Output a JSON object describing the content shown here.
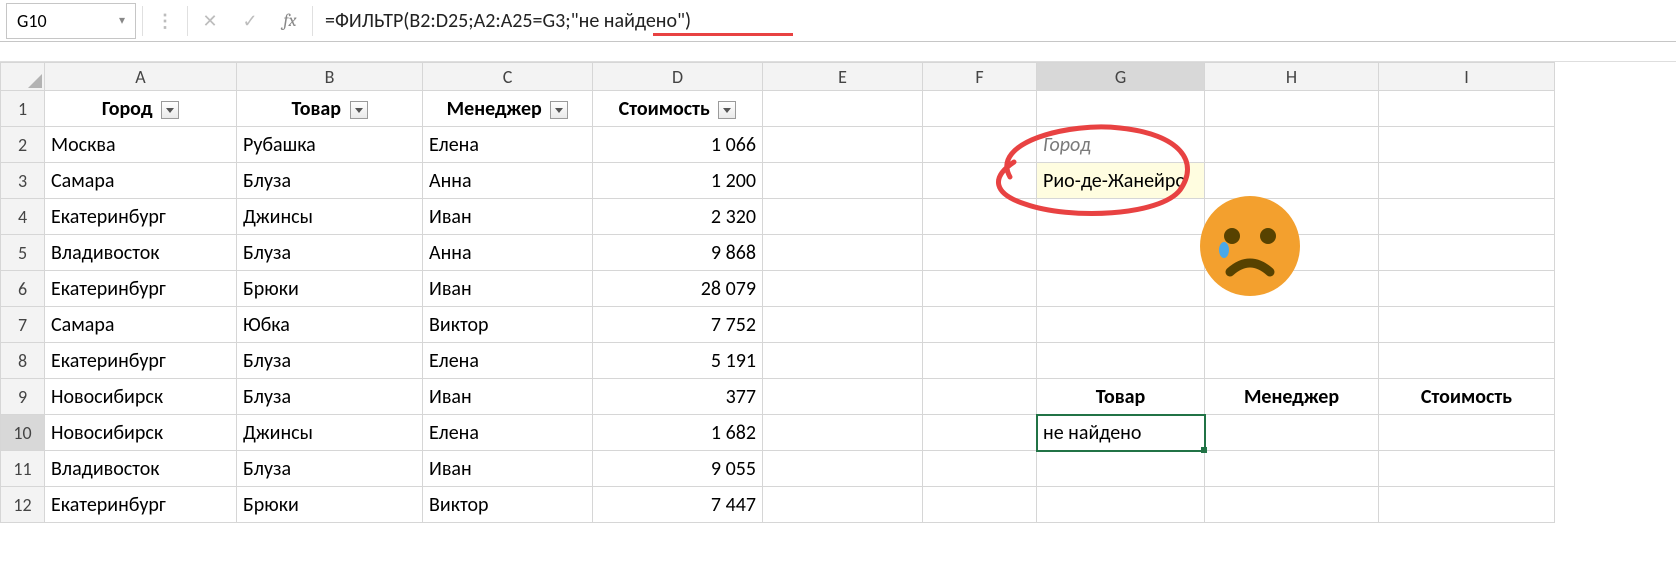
{
  "app": {
    "name_box": "G10",
    "formula": "=ФИЛЬТР(B2:D25;A2:A25=G3;\"не найдено\")"
  },
  "columns": [
    "A",
    "B",
    "C",
    "D",
    "E",
    "F",
    "G",
    "H",
    "I"
  ],
  "row_numbers": [
    1,
    2,
    3,
    4,
    5,
    6,
    7,
    8,
    9,
    10,
    11,
    12
  ],
  "table_headers": {
    "A": "Город",
    "B": "Товар",
    "C": "Менеджер",
    "D": "Стоимость"
  },
  "rows": [
    {
      "A": "Москва",
      "B": "Рубашка",
      "C": "Елена",
      "D": "1 066"
    },
    {
      "A": "Самара",
      "B": "Блуза",
      "C": "Анна",
      "D": "1 200"
    },
    {
      "A": "Екатеринбург",
      "B": "Джинсы",
      "C": "Иван",
      "D": "2 320"
    },
    {
      "A": "Владивосток",
      "B": "Блуза",
      "C": "Анна",
      "D": "9 868"
    },
    {
      "A": "Екатеринбург",
      "B": "Брюки",
      "C": "Иван",
      "D": "28 079"
    },
    {
      "A": "Самара",
      "B": "Юбка",
      "C": "Виктор",
      "D": "7 752"
    },
    {
      "A": "Екатеринбург",
      "B": "Блуза",
      "C": "Елена",
      "D": "5 191"
    },
    {
      "A": "Новосибирск",
      "B": "Блуза",
      "C": "Иван",
      "D": "377"
    },
    {
      "A": "Новосибирск",
      "B": "Джинсы",
      "C": "Елена",
      "D": "1 682"
    },
    {
      "A": "Владивосток",
      "B": "Блуза",
      "C": "Иван",
      "D": "9 055"
    },
    {
      "A": "Екатеринбург",
      "B": "Брюки",
      "C": "Виктор",
      "D": "7 447"
    }
  ],
  "side": {
    "g2_label": "Город",
    "g3_value": "Рио-де-Жанейро",
    "result_headers": {
      "G": "Товар",
      "H": "Менеджер",
      "I": "Стоимость"
    },
    "g10_value": "не найдено"
  },
  "icons": {
    "fx": "fx",
    "check": "✓",
    "cross": "✕",
    "dots": "⋮",
    "dropdown": "▾"
  }
}
